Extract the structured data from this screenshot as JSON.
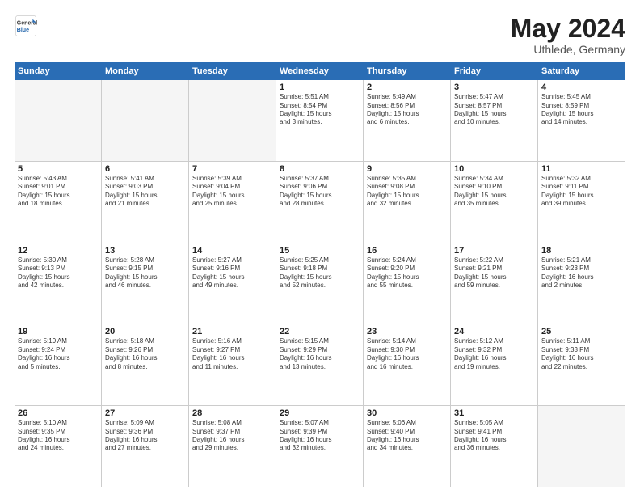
{
  "header": {
    "logo": {
      "line1": "General",
      "line2": "Blue"
    },
    "title": "May 2024",
    "location": "Uthlede, Germany"
  },
  "weekdays": [
    "Sunday",
    "Monday",
    "Tuesday",
    "Wednesday",
    "Thursday",
    "Friday",
    "Saturday"
  ],
  "rows": [
    [
      {
        "day": "",
        "text": "",
        "empty": true
      },
      {
        "day": "",
        "text": "",
        "empty": true
      },
      {
        "day": "",
        "text": "",
        "empty": true
      },
      {
        "day": "1",
        "text": "Sunrise: 5:51 AM\nSunset: 8:54 PM\nDaylight: 15 hours\nand 3 minutes."
      },
      {
        "day": "2",
        "text": "Sunrise: 5:49 AM\nSunset: 8:56 PM\nDaylight: 15 hours\nand 6 minutes."
      },
      {
        "day": "3",
        "text": "Sunrise: 5:47 AM\nSunset: 8:57 PM\nDaylight: 15 hours\nand 10 minutes."
      },
      {
        "day": "4",
        "text": "Sunrise: 5:45 AM\nSunset: 8:59 PM\nDaylight: 15 hours\nand 14 minutes."
      }
    ],
    [
      {
        "day": "5",
        "text": "Sunrise: 5:43 AM\nSunset: 9:01 PM\nDaylight: 15 hours\nand 18 minutes."
      },
      {
        "day": "6",
        "text": "Sunrise: 5:41 AM\nSunset: 9:03 PM\nDaylight: 15 hours\nand 21 minutes."
      },
      {
        "day": "7",
        "text": "Sunrise: 5:39 AM\nSunset: 9:04 PM\nDaylight: 15 hours\nand 25 minutes."
      },
      {
        "day": "8",
        "text": "Sunrise: 5:37 AM\nSunset: 9:06 PM\nDaylight: 15 hours\nand 28 minutes."
      },
      {
        "day": "9",
        "text": "Sunrise: 5:35 AM\nSunset: 9:08 PM\nDaylight: 15 hours\nand 32 minutes."
      },
      {
        "day": "10",
        "text": "Sunrise: 5:34 AM\nSunset: 9:10 PM\nDaylight: 15 hours\nand 35 minutes."
      },
      {
        "day": "11",
        "text": "Sunrise: 5:32 AM\nSunset: 9:11 PM\nDaylight: 15 hours\nand 39 minutes."
      }
    ],
    [
      {
        "day": "12",
        "text": "Sunrise: 5:30 AM\nSunset: 9:13 PM\nDaylight: 15 hours\nand 42 minutes."
      },
      {
        "day": "13",
        "text": "Sunrise: 5:28 AM\nSunset: 9:15 PM\nDaylight: 15 hours\nand 46 minutes."
      },
      {
        "day": "14",
        "text": "Sunrise: 5:27 AM\nSunset: 9:16 PM\nDaylight: 15 hours\nand 49 minutes."
      },
      {
        "day": "15",
        "text": "Sunrise: 5:25 AM\nSunset: 9:18 PM\nDaylight: 15 hours\nand 52 minutes."
      },
      {
        "day": "16",
        "text": "Sunrise: 5:24 AM\nSunset: 9:20 PM\nDaylight: 15 hours\nand 55 minutes."
      },
      {
        "day": "17",
        "text": "Sunrise: 5:22 AM\nSunset: 9:21 PM\nDaylight: 15 hours\nand 59 minutes."
      },
      {
        "day": "18",
        "text": "Sunrise: 5:21 AM\nSunset: 9:23 PM\nDaylight: 16 hours\nand 2 minutes."
      }
    ],
    [
      {
        "day": "19",
        "text": "Sunrise: 5:19 AM\nSunset: 9:24 PM\nDaylight: 16 hours\nand 5 minutes."
      },
      {
        "day": "20",
        "text": "Sunrise: 5:18 AM\nSunset: 9:26 PM\nDaylight: 16 hours\nand 8 minutes."
      },
      {
        "day": "21",
        "text": "Sunrise: 5:16 AM\nSunset: 9:27 PM\nDaylight: 16 hours\nand 11 minutes."
      },
      {
        "day": "22",
        "text": "Sunrise: 5:15 AM\nSunset: 9:29 PM\nDaylight: 16 hours\nand 13 minutes."
      },
      {
        "day": "23",
        "text": "Sunrise: 5:14 AM\nSunset: 9:30 PM\nDaylight: 16 hours\nand 16 minutes."
      },
      {
        "day": "24",
        "text": "Sunrise: 5:12 AM\nSunset: 9:32 PM\nDaylight: 16 hours\nand 19 minutes."
      },
      {
        "day": "25",
        "text": "Sunrise: 5:11 AM\nSunset: 9:33 PM\nDaylight: 16 hours\nand 22 minutes."
      }
    ],
    [
      {
        "day": "26",
        "text": "Sunrise: 5:10 AM\nSunset: 9:35 PM\nDaylight: 16 hours\nand 24 minutes."
      },
      {
        "day": "27",
        "text": "Sunrise: 5:09 AM\nSunset: 9:36 PM\nDaylight: 16 hours\nand 27 minutes."
      },
      {
        "day": "28",
        "text": "Sunrise: 5:08 AM\nSunset: 9:37 PM\nDaylight: 16 hours\nand 29 minutes."
      },
      {
        "day": "29",
        "text": "Sunrise: 5:07 AM\nSunset: 9:39 PM\nDaylight: 16 hours\nand 32 minutes."
      },
      {
        "day": "30",
        "text": "Sunrise: 5:06 AM\nSunset: 9:40 PM\nDaylight: 16 hours\nand 34 minutes."
      },
      {
        "day": "31",
        "text": "Sunrise: 5:05 AM\nSunset: 9:41 PM\nDaylight: 16 hours\nand 36 minutes."
      },
      {
        "day": "",
        "text": "",
        "empty": true
      }
    ]
  ]
}
